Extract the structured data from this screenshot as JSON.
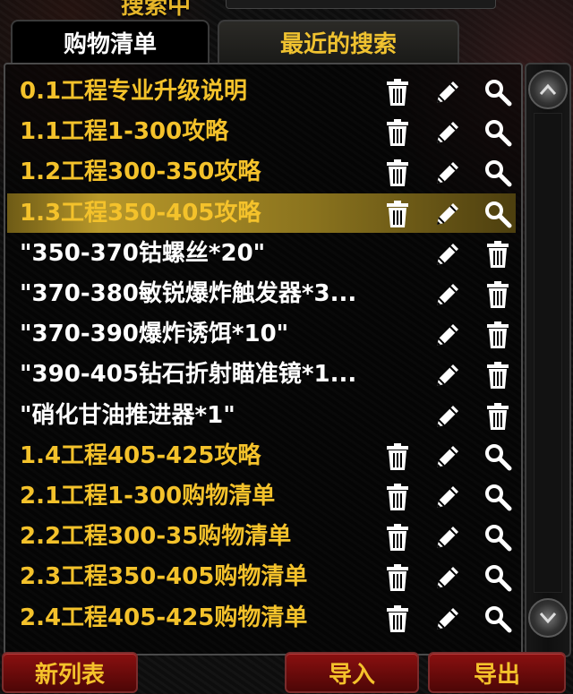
{
  "header": {
    "label_partial": "搜索中"
  },
  "tabs": [
    {
      "label": "购物清单",
      "active": true
    },
    {
      "label": "最近的搜索",
      "active": false
    }
  ],
  "colors": {
    "gold": "#f4c22b",
    "white": "#ffffff",
    "selected_bg": "#b8982a",
    "button_red": "#8a1010"
  },
  "list": {
    "items": [
      {
        "label": "0.1工程专业升级说明",
        "style": "gold",
        "icons": [
          "trash-icon",
          "pencil-icon",
          "magnifier-icon"
        ]
      },
      {
        "label": "1.1工程1-300攻略",
        "style": "gold",
        "icons": [
          "trash-icon",
          "pencil-icon",
          "magnifier-icon"
        ]
      },
      {
        "label": "1.2工程300-350攻略",
        "style": "gold",
        "icons": [
          "trash-icon",
          "pencil-icon",
          "magnifier-icon"
        ]
      },
      {
        "label": "1.3工程350-405攻略",
        "style": "gold",
        "selected": true,
        "icons": [
          "trash-icon",
          "pencil-icon",
          "magnifier-icon"
        ]
      },
      {
        "label": "\"350-370钴螺丝*20\"",
        "style": "white",
        "icons": [
          "pencil-icon",
          "trash-icon"
        ]
      },
      {
        "label": "\"370-380敏锐爆炸触发器*3...",
        "style": "white",
        "icons": [
          "pencil-icon",
          "trash-icon"
        ]
      },
      {
        "label": "\"370-390爆炸诱饵*10\"",
        "style": "white",
        "icons": [
          "pencil-icon",
          "trash-icon"
        ]
      },
      {
        "label": "\"390-405钻石折射瞄准镜*1...",
        "style": "white",
        "icons": [
          "pencil-icon",
          "trash-icon"
        ]
      },
      {
        "label": "\"硝化甘油推进器*1\"",
        "style": "white",
        "icons": [
          "pencil-icon",
          "trash-icon"
        ]
      },
      {
        "label": "1.4工程405-425攻略",
        "style": "gold",
        "icons": [
          "trash-icon",
          "pencil-icon",
          "magnifier-icon"
        ]
      },
      {
        "label": "2.1工程1-300购物清单",
        "style": "gold",
        "icons": [
          "trash-icon",
          "pencil-icon",
          "magnifier-icon"
        ]
      },
      {
        "label": "2.2工程300-35购物清单",
        "style": "gold",
        "icons": [
          "trash-icon",
          "pencil-icon",
          "magnifier-icon"
        ]
      },
      {
        "label": "2.3工程350-405购物清单",
        "style": "gold",
        "icons": [
          "trash-icon",
          "pencil-icon",
          "magnifier-icon"
        ]
      },
      {
        "label": "2.4工程405-425购物清单",
        "style": "gold",
        "icons": [
          "trash-icon",
          "pencil-icon",
          "magnifier-icon"
        ]
      }
    ]
  },
  "buttons": {
    "new_list": "新列表",
    "import": "导入",
    "export": "导出"
  }
}
